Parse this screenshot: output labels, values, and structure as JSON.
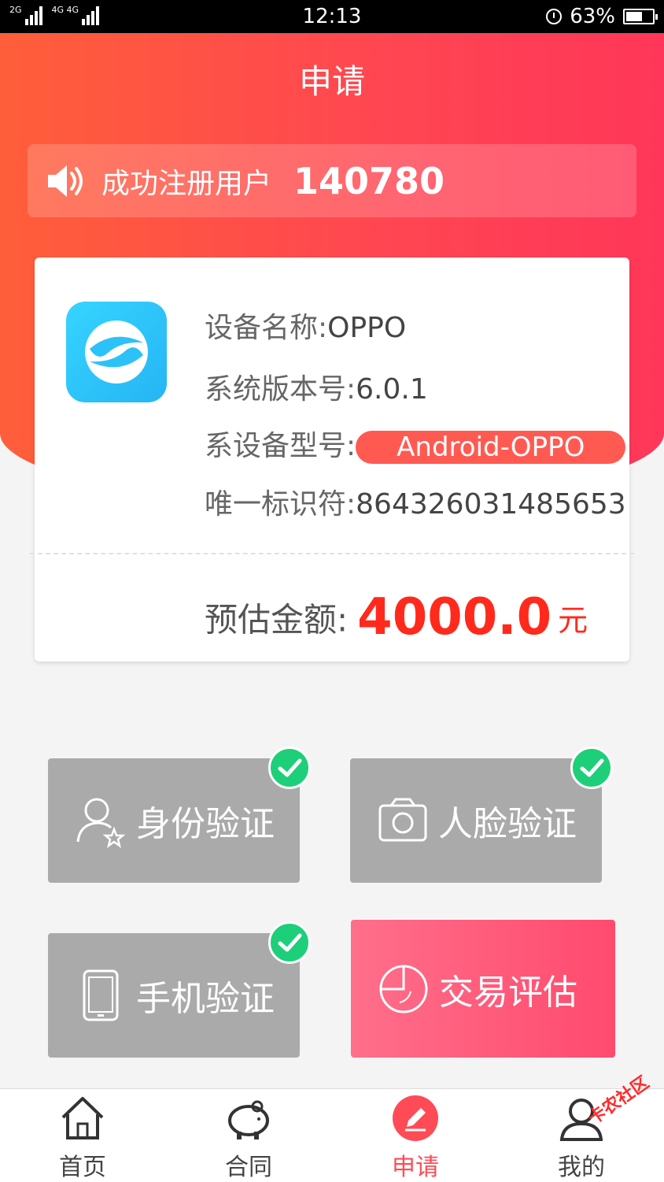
{
  "status_bar": {
    "signal1_label": "2G",
    "signal2_label": "4G 4G",
    "time": "12:13",
    "battery_percent": "63%",
    "battery_level": 0.63
  },
  "header": {
    "title": "申请"
  },
  "notice": {
    "label": "成功注册用户",
    "count": "140780"
  },
  "device_card": {
    "device_name_label": "设备名称:",
    "device_name": "OPPO",
    "os_version_label": "系统版本号:",
    "os_version": "6.0.1",
    "model_label": "系设备型号:",
    "model": "Android-OPPO",
    "uid_label": "唯一标识符:",
    "uid": "864326031485653",
    "amount_label": "预估金额:",
    "amount": "4000.0",
    "amount_unit": "元"
  },
  "actions": [
    {
      "label": "身份验证",
      "verified": true,
      "icon": "person-star-icon"
    },
    {
      "label": "人脸验证",
      "verified": true,
      "icon": "camera-icon"
    },
    {
      "label": "手机验证",
      "verified": true,
      "icon": "phone-icon"
    },
    {
      "label": "交易评估",
      "verified": false,
      "icon": "pie-chart-icon"
    }
  ],
  "tabbar": [
    {
      "label": "首页",
      "icon": "home-icon",
      "active": false
    },
    {
      "label": "合同",
      "icon": "piggy-bank-icon",
      "active": false
    },
    {
      "label": "申请",
      "icon": "pencil-icon",
      "active": true
    },
    {
      "label": "我的",
      "icon": "user-icon",
      "active": false
    }
  ],
  "watermark": "卡农社区",
  "colors": {
    "accent": "#ff4b55",
    "header_start": "#ff5e3a",
    "header_end": "#ff3659",
    "check": "#1ecf79",
    "amount": "#ff2a1c"
  }
}
